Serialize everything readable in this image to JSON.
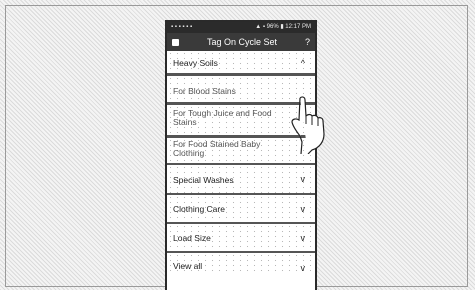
{
  "status_bar": {
    "left_icons": "▪ ▪ ▪ ▪ ▪ ▪",
    "right_text": "▲ ▪ 96% ▮ 12:17 PM"
  },
  "header": {
    "title": "Tag On Cycle Set",
    "help_label": "?"
  },
  "menu": {
    "heavy_soils": {
      "label": "Heavy Soils",
      "chevron": "^"
    },
    "sub_items": [
      {
        "label": "For Blood Stains"
      },
      {
        "label": "For Tough Juice and Food Stains"
      },
      {
        "label": "For Food Stained Baby Clothing"
      }
    ],
    "categories": [
      {
        "label": "Special Washes",
        "chevron": "v"
      },
      {
        "label": "Clothing Care",
        "chevron": "v"
      },
      {
        "label": "Load Size",
        "chevron": "v"
      },
      {
        "label": "View all",
        "chevron": "v"
      }
    ]
  }
}
